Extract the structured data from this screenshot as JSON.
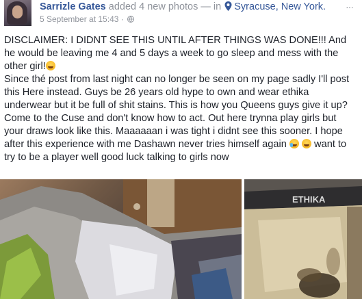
{
  "post": {
    "author": "Sarrizle Gates",
    "action": "added 4 new photos",
    "connector": "— in",
    "location": "Syracuse, New York.",
    "timestamp": "5 September at 15:43 ·",
    "more_label": "···"
  },
  "text": {
    "line1": "DISCLAIMER: I DIDNT SEE THIS UNTIL AFTER THINGS WAS DONE!!! And",
    "line2": "he would be leaving me 4 and 5 days a week to go sleep and mess with the",
    "line3": "other girl!",
    "line4": "Since thé post from last night can no longer be seen on my page sadly I'll post",
    "line5": "this Here instead. Guys be 26 years old hype to own and wear ethika",
    "line6": "underwear but it be full of shit stains. This is how you Queens guys give it up?",
    "line7": "Come to the Cuse and don't know how to act. Out here trynna play girls but",
    "line8": "your draws look like this. Maaaaaan i was tight i didnt see this sooner. I hope",
    "line9a": "after this experience with me Dashawn never tries himself again",
    "line9b": " want to",
    "line10": "try to be a player well good luck talking to girls now"
  },
  "icons": {
    "pin": "location-pin-icon",
    "globe": "public-globe-icon",
    "more": "more-options-icon",
    "emoji_laugh": "tears-of-joy-emoji",
    "emoji_cry": "crying-emoji"
  },
  "photos": {
    "count": 2,
    "left_label": "",
    "right_waistband_text": "ETHIKA"
  },
  "colors": {
    "link": "#365899",
    "meta": "#90949c",
    "text": "#1d2129"
  }
}
